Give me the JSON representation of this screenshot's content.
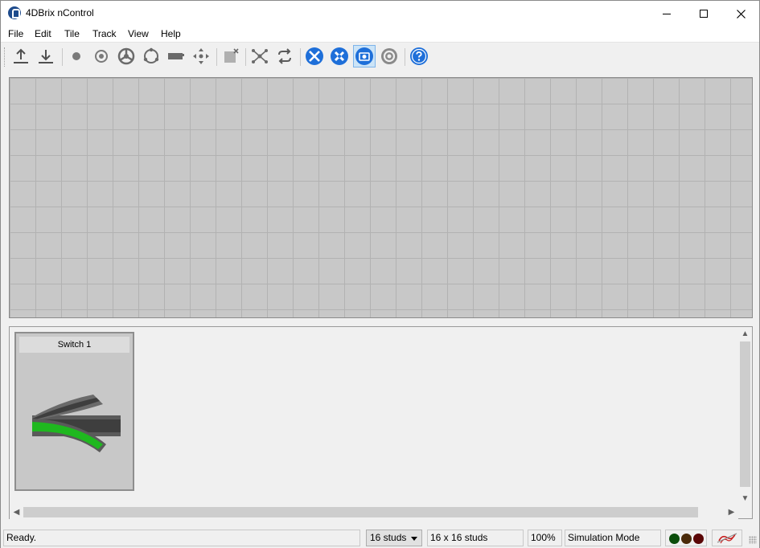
{
  "window": {
    "title": "4DBrix nControl"
  },
  "menu": {
    "items": [
      {
        "label": "File"
      },
      {
        "label": "Edit"
      },
      {
        "label": "Tile"
      },
      {
        "label": "Track"
      },
      {
        "label": "View"
      },
      {
        "label": "Help"
      }
    ]
  },
  "toolbar": {
    "buttons": [
      {
        "icon": "upload-icon"
      },
      {
        "icon": "download-icon"
      },
      {
        "icon": "dot-icon"
      },
      {
        "icon": "target-icon"
      },
      {
        "icon": "wheel-icon"
      },
      {
        "icon": "circle-arrows-icon"
      },
      {
        "icon": "rail-icon"
      },
      {
        "icon": "move-icon"
      },
      {
        "icon": "delete-tile-icon"
      },
      {
        "icon": "network-icon"
      },
      {
        "icon": "refresh-icon"
      },
      {
        "icon": "tools-icon"
      },
      {
        "icon": "wrench-screwdriver-icon"
      },
      {
        "icon": "camera-icon",
        "active": true
      },
      {
        "icon": "settings-icon"
      },
      {
        "icon": "help-icon"
      }
    ]
  },
  "tiles": [
    {
      "label": "Switch 1",
      "icon": "track-switch-icon"
    }
  ],
  "status": {
    "message": "Ready.",
    "stud_size": "16 studs",
    "grid_size": "16 x 16 studs",
    "zoom": "100%",
    "mode": "Simulation Mode",
    "lights": [
      "#0b4d0b",
      "#4a2a0a",
      "#5a0606"
    ]
  },
  "colors": {
    "accent": "#1e6fd9",
    "track_active": "#1fb81f",
    "track_rail": "#4a4a4a"
  }
}
